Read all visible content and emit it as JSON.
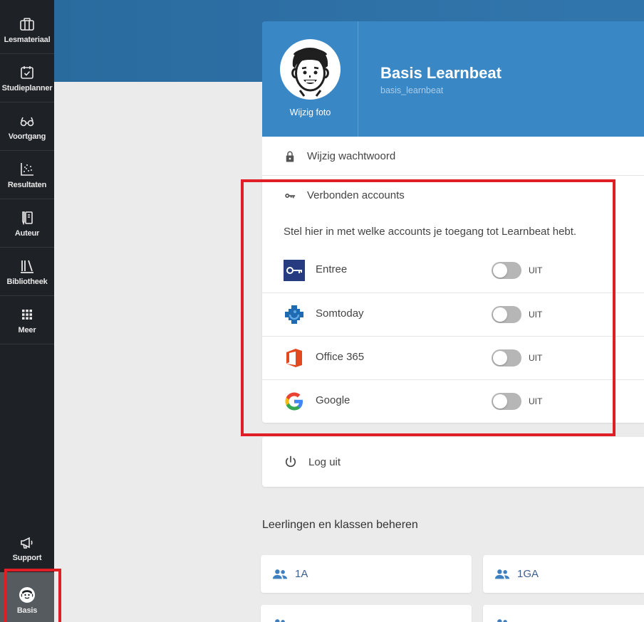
{
  "sidebar": {
    "items": [
      {
        "label": "Lesmateriaal",
        "icon": "briefcase-icon"
      },
      {
        "label": "Studieplanner",
        "icon": "calendar-check-icon"
      },
      {
        "label": "Voortgang",
        "icon": "glasses-icon"
      },
      {
        "label": "Resultaten",
        "icon": "scatter-chart-icon"
      },
      {
        "label": "Auteur",
        "icon": "pen-book-icon"
      },
      {
        "label": "Bibliotheek",
        "icon": "library-icon"
      },
      {
        "label": "Meer",
        "icon": "grid-icon"
      }
    ],
    "support": {
      "label": "Support",
      "icon": "megaphone-icon"
    },
    "profile": {
      "label": "Basis",
      "icon": "avatar-icon"
    }
  },
  "profile": {
    "change_photo": "Wijzig foto",
    "name": "Basis Learnbeat",
    "username": "basis_learnbeat"
  },
  "password": {
    "label": "Wijzig wachtwoord",
    "icon": "lock-icon"
  },
  "accounts": {
    "title": "Verbonden accounts",
    "icon": "key-icon",
    "description": "Stel hier in met welke accounts je toegang tot Learnbeat hebt.",
    "items": [
      {
        "name": "Entree",
        "state": "UIT",
        "enabled": false,
        "icon": "entree-logo-icon"
      },
      {
        "name": "Somtoday",
        "state": "UIT",
        "enabled": false,
        "icon": "somtoday-logo-icon"
      },
      {
        "name": "Office 365",
        "state": "UIT",
        "enabled": false,
        "icon": "office365-logo-icon"
      },
      {
        "name": "Google",
        "state": "UIT",
        "enabled": false,
        "icon": "google-logo-icon"
      }
    ]
  },
  "logout": {
    "label": "Log uit",
    "icon": "power-icon"
  },
  "classes": {
    "title": "Leerlingen en klassen beheren",
    "items": [
      {
        "label": "1A",
        "icon": "group-icon"
      },
      {
        "label": "1GA",
        "icon": "group-icon"
      },
      {
        "label": "",
        "icon": "group-icon"
      },
      {
        "label": "",
        "icon": "group-icon"
      }
    ]
  },
  "colors": {
    "sidebar": "#1e2226",
    "header_blue": "#3a87c6",
    "highlight_red": "#e01e26",
    "toggle_off": "#b6b6b6"
  }
}
